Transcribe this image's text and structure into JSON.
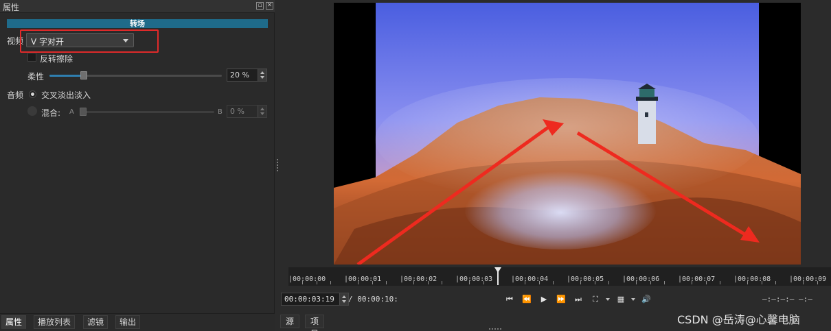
{
  "panel": {
    "title": "属性",
    "float_icon": "float-icon",
    "close_icon": "close-icon"
  },
  "transition": {
    "section_title": "转场",
    "video_label": "视频",
    "video_selected": "V 字对开",
    "reverse_label": "反转擦除",
    "softness_label": "柔性",
    "softness_value": "20 %",
    "softness_level": 0.2,
    "audio_label": "音频",
    "crossfade_label": "交叉淡出淡入",
    "mix_label": "混合:",
    "mix_a": "A",
    "mix_b": "B",
    "mix_value": "0 %"
  },
  "left_tabs": [
    "属性",
    "播放列表",
    "滤镜",
    "输出"
  ],
  "ruler": {
    "labels": [
      "|00:00:00",
      "|00:00:01",
      "|00:00:02",
      "|00:00:03",
      "|00:00:04",
      "|00:00:05",
      "|00:00:06",
      "|00:00:07",
      "|00:00:08",
      "|00:00:09"
    ]
  },
  "transport": {
    "position": "00:00:03:19",
    "duration": "/ 00:00:10:",
    "in_out": "—:—:—:— —:—",
    "buttons": [
      "skip-to-start-icon",
      "rewind-icon",
      "play-icon",
      "fast-forward-icon",
      "skip-to-end-icon",
      "zoom-icon",
      "grid-icon",
      "volume-icon"
    ]
  },
  "right_tabs": [
    "源",
    "项目"
  ],
  "watermark": "CSDN @岳涛@心馨电脑",
  "colors": {
    "accent": "#1f6b8a",
    "highlight": "#e02a2a",
    "arrow": "#ee2a1f"
  }
}
